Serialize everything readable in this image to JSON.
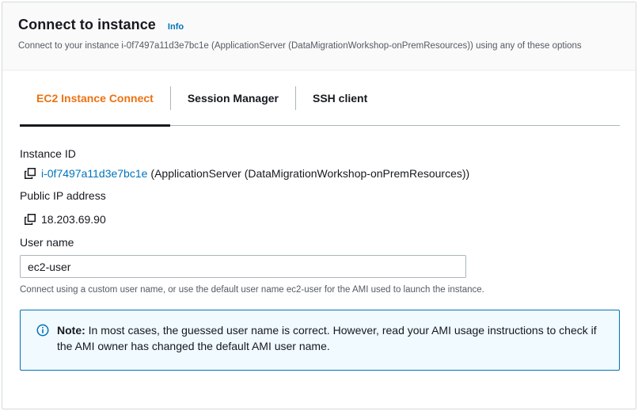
{
  "header": {
    "title": "Connect to instance",
    "info_label": "Info",
    "description": "Connect to your instance i-0f7497a11d3e7bc1e (ApplicationServer (DataMigrationWorkshop-onPremResources)) using any of these options"
  },
  "tabs": [
    {
      "label": "EC2 Instance Connect",
      "active": true
    },
    {
      "label": "Session Manager",
      "active": false
    },
    {
      "label": "SSH client",
      "active": false
    }
  ],
  "instance": {
    "label": "Instance ID",
    "id": "i-0f7497a11d3e7bc1e",
    "name": "(ApplicationServer (DataMigrationWorkshop-onPremResources))"
  },
  "public_ip": {
    "label": "Public IP address",
    "value": "18.203.69.90"
  },
  "user_name": {
    "label": "User name",
    "value": "ec2-user",
    "hint": "Connect using a custom user name, or use the default user name ec2-user for the AMI used to launch the instance."
  },
  "note": {
    "strong": "Note:",
    "text": "In most cases, the guessed user name is correct. However, read your AMI usage instructions to check if the AMI owner has changed the default AMI user name."
  },
  "icons": {
    "copy": "copy-icon",
    "info": "info-circle-icon"
  },
  "colors": {
    "accent_orange": "#ec7211",
    "link_blue": "#0073bb",
    "note_bg": "#f1faff",
    "text": "#16191f",
    "muted": "#545b64"
  }
}
